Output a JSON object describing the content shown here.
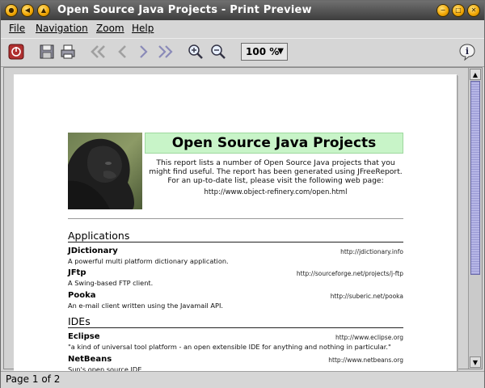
{
  "window": {
    "title": "Open Source Java Projects - Print Preview"
  },
  "menu": {
    "items": [
      {
        "label": "File"
      },
      {
        "label": "Navigation"
      },
      {
        "label": "Zoom"
      },
      {
        "label": "Help"
      }
    ]
  },
  "toolbar": {
    "icons": [
      "close-report-icon",
      "save-icon",
      "print-icon",
      "first-page-icon",
      "previous-page-icon",
      "next-page-icon",
      "last-page-icon",
      "zoom-in-icon",
      "zoom-out-icon",
      "info-icon"
    ],
    "zoom_value": "100 %"
  },
  "report": {
    "title": "Open Source Java Projects",
    "description": "This report lists a number of Open Source Java projects that you might find useful.  The report has been generated using JFreeReport.  For an up-to-date list, please visit the following web page:",
    "url": "http://www.object-refinery.com/open.html",
    "sections": [
      {
        "heading": "Applications",
        "entries": [
          {
            "name": "JDictionary",
            "url": "http://jdictionary.info",
            "description": "A powerful multi platform dictionary application."
          },
          {
            "name": "JFtp",
            "url": "http://sourceforge.net/projects/j-ftp",
            "description": "A Swing-based FTP client."
          },
          {
            "name": "Pooka",
            "url": "http://suberic.net/pooka",
            "description": "An e-mail client written using the Javamail API."
          }
        ]
      },
      {
        "heading": "IDEs",
        "entries": [
          {
            "name": "Eclipse",
            "url": "http://www.eclipse.org",
            "description": "\"a kind of universal tool platform - an open extensible IDE for anything and nothing in particular.\""
          },
          {
            "name": "NetBeans",
            "url": "http://www.netbeans.org",
            "description": "Sun's open source IDE."
          }
        ]
      }
    ]
  },
  "status": {
    "text": "Page 1 of 2"
  },
  "colors": {
    "title_band": "#c8f4c8",
    "window_bg": "#d6d6d6",
    "titlebar": "#4a4a4a",
    "scroll_thumb": "#aaaadd"
  }
}
